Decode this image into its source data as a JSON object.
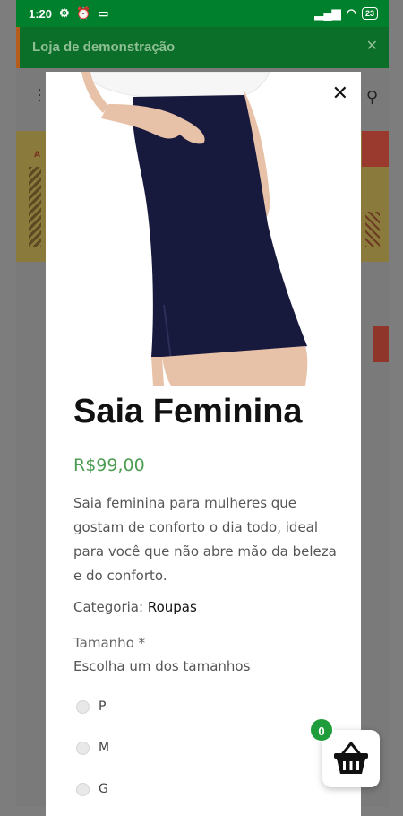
{
  "status_bar": {
    "time": "1:20",
    "battery": "23"
  },
  "banner": {
    "title": "Loja de demonstração",
    "close_icon": "close-icon"
  },
  "product": {
    "title": "Saia Feminina",
    "price": "R$99,00",
    "description": "Saia feminina para mulheres que gostam de conforto o dia todo, ideal para você que não abre mão da beleza e do conforto.",
    "category_label": "Categoria:",
    "category_value": "Roupas",
    "size_label": "Tamanho *",
    "size_hint": "Escolha um dos tamanhos",
    "sizes": [
      "P",
      "M",
      "G"
    ]
  },
  "cart": {
    "count": "0"
  },
  "colors": {
    "status_green": "#00802d",
    "banner_green": "#0b6e29",
    "price_green": "#4c9d52",
    "badge_green": "#1f9d3a"
  }
}
